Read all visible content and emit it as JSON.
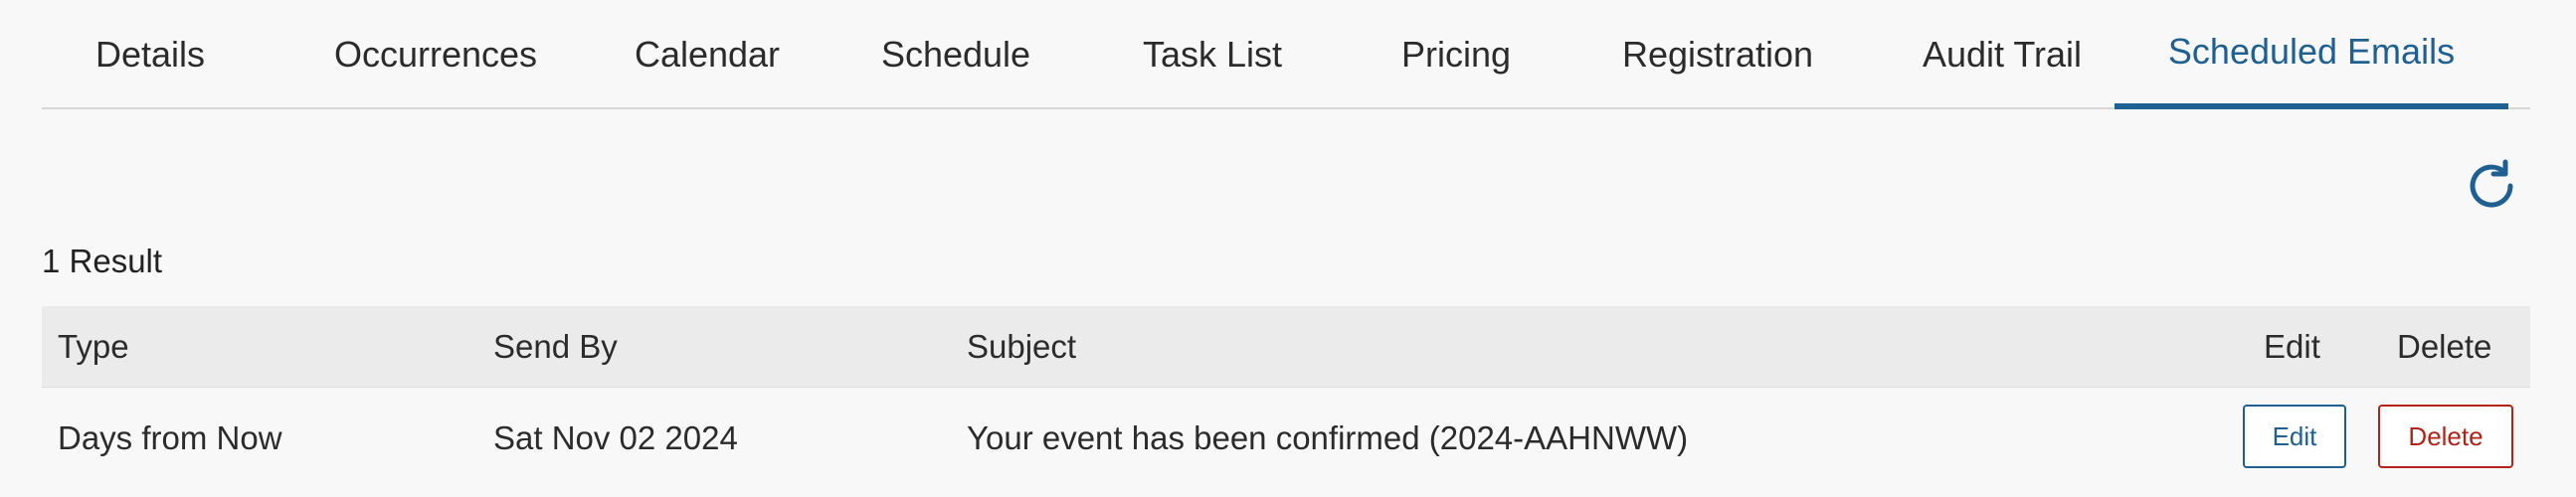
{
  "tabs": [
    {
      "label": "Details"
    },
    {
      "label": "Occurrences"
    },
    {
      "label": "Calendar"
    },
    {
      "label": "Schedule"
    },
    {
      "label": "Task List"
    },
    {
      "label": "Pricing"
    },
    {
      "label": "Registration"
    },
    {
      "label": "Audit Trail"
    },
    {
      "label": "Scheduled Emails"
    }
  ],
  "active_tab": "Scheduled Emails",
  "accent_color": "#1f6093",
  "danger_color": "#b42318",
  "refresh_icon": "refresh-icon",
  "results": {
    "count_label": "1 Result"
  },
  "table": {
    "headers": {
      "type": "Type",
      "send_by": "Send By",
      "subject": "Subject",
      "edit": "Edit",
      "delete": "Delete"
    },
    "rows": [
      {
        "type": "Days from Now",
        "send_by": "Sat Nov 02 2024",
        "subject": "Your event has been confirmed (2024-AAHNWW)",
        "edit_label": "Edit",
        "delete_label": "Delete"
      }
    ]
  }
}
